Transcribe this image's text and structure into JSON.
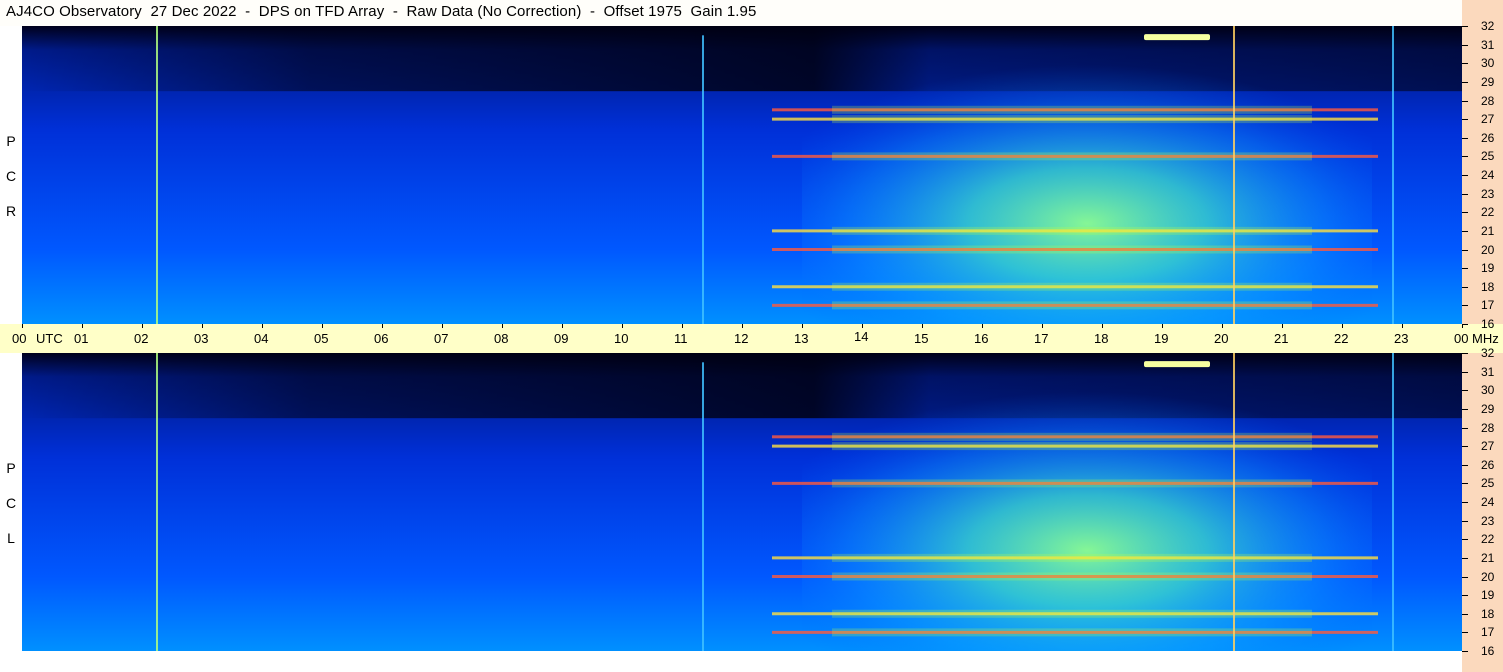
{
  "title": "AJ4CO Observatory  27 Dec 2022  -  DPS on TFD Array  -  Raw Data (No Correction)  -  Offset 1975  Gain 1.95",
  "panels": [
    {
      "name": "rcp",
      "letters": [
        "R",
        "C",
        "P"
      ]
    },
    {
      "name": "lcp",
      "letters": [
        "L",
        "C",
        "P"
      ]
    }
  ],
  "colors": {
    "background": "#ffffff",
    "axis_band": "#ffffc8",
    "freq_strip": "#fbd9bd",
    "colormap_low": "#000018",
    "colormap_mid": "#0050ff",
    "colormap_high": "#7dffa0"
  },
  "chart_data": {
    "type": "heatmap",
    "title": "AJ4CO Observatory  27 Dec 2022  -  DPS on TFD Array  -  Raw Data (No Correction)  -  Offset 1975  Gain 1.95",
    "x_axis": {
      "unit_label": "UTC",
      "range": [
        0,
        24
      ],
      "tick_labels": [
        "00",
        "01",
        "02",
        "03",
        "04",
        "05",
        "06",
        "07",
        "08",
        "09",
        "10",
        "11",
        "12",
        "13",
        "14",
        "15",
        "16",
        "17",
        "18",
        "19",
        "20",
        "21",
        "22",
        "23",
        "00"
      ]
    },
    "y_axis": {
      "unit_label": "MHz",
      "range": [
        16,
        32
      ],
      "tick_labels": [
        "32",
        "31",
        "30",
        "29",
        "28",
        "27",
        "26",
        "25",
        "24",
        "23",
        "22",
        "21",
        "20",
        "19",
        "18",
        "17",
        "16"
      ]
    },
    "series": [
      {
        "name": "RCP"
      },
      {
        "name": "LCP"
      }
    ],
    "features": {
      "vertical_lines_utc": [
        2.25,
        11.35,
        20.2,
        22.85
      ],
      "burst_utc": [
        18.7,
        19.8
      ],
      "burst_mhz": 31.4,
      "dense_band_mhz": [
        27.5,
        27.0,
        25.0,
        21.0,
        20.0,
        18.0,
        17.0
      ],
      "bright_region_utc": [
        13.0,
        22.5
      ]
    }
  }
}
